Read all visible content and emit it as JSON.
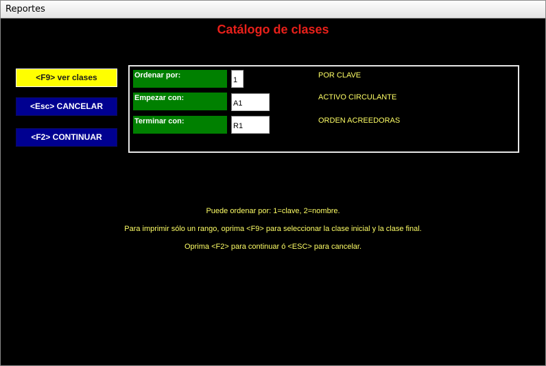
{
  "window": {
    "title": "Reportes"
  },
  "heading": "Catálogo de clases",
  "buttons": {
    "f9": "<F9> ver clases",
    "esc": "<Esc> CANCELAR",
    "f2": "<F2> CONTINUAR"
  },
  "form": {
    "order": {
      "label": "Ordenar por:",
      "value": "1",
      "description": "POR CLAVE"
    },
    "start": {
      "label": "Empezar con:",
      "value": "A1",
      "description": "ACTIVO CIRCULANTE"
    },
    "end": {
      "label": "Terminar con:",
      "value": "R1",
      "description": "ORDEN ACREEDORAS"
    }
  },
  "messages": [
    "Puede ordenar por: 1=clave, 2=nombre.",
    "Para imprimir sólo un rango, oprima <F9> para seleccionar la clase inicial y la clase final.",
    "Oprima <F2> para continuar ó <ESC> para cancelar."
  ],
  "colors": {
    "heading": "#e8201a",
    "label_bg": "#008000",
    "primary_button": "#ffff00",
    "secondary_button": "#000090",
    "message_text": "#ffff66"
  }
}
